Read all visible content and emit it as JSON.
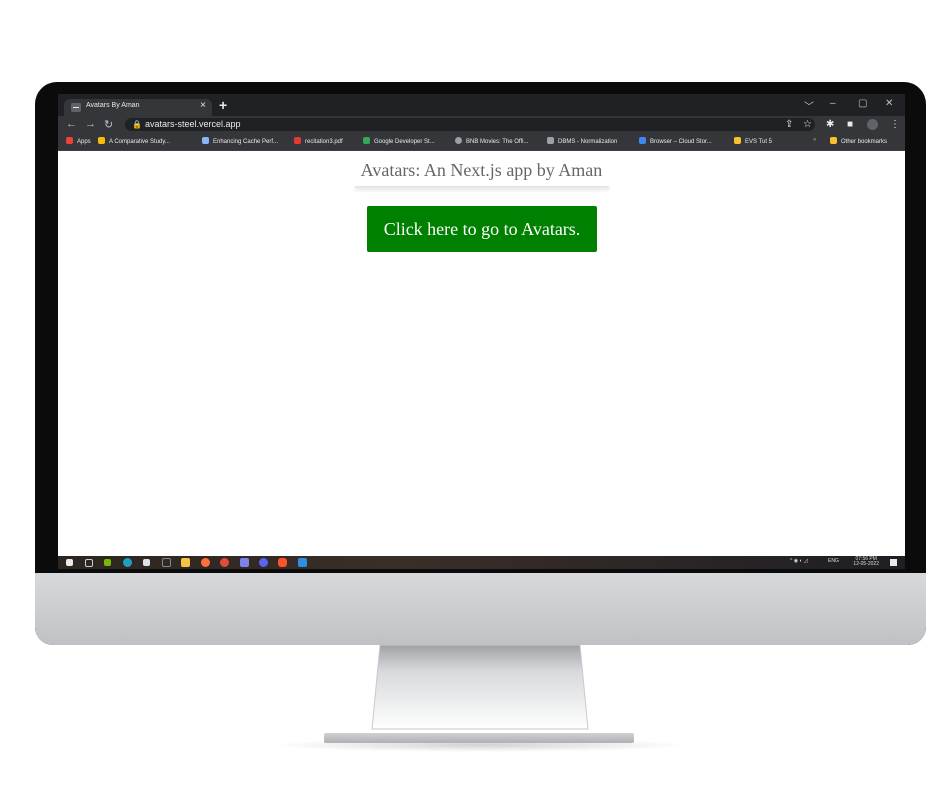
{
  "browser": {
    "tab_title": "Avatars By Aman",
    "tab_close": "×",
    "new_tab": "+",
    "url": "avatars-steel.vercel.app",
    "window_controls": [
      "﹀",
      "–",
      "▢",
      "✕"
    ]
  },
  "bookmarks": [
    {
      "label": "Apps",
      "color": "#ea4335"
    },
    {
      "label": "A Comparative Study...",
      "color": "#fbbc05"
    },
    {
      "label": "Enhancing Cache Perf...",
      "color": "#8ab4f8"
    },
    {
      "label": "recitation3.pdf",
      "color": "#e53935"
    },
    {
      "label": "Google Developer St...",
      "color": "#34a853"
    },
    {
      "label": "BNB Movies: The Offi...",
      "color": "#9aa0a6"
    },
    {
      "label": "DBMS - Normalization",
      "color": "#9aa0a6"
    },
    {
      "label": "Browser – Cloud Stor...",
      "color": "#4285f4"
    },
    {
      "label": "EVS Tut 5",
      "color": "#fbc02d"
    }
  ],
  "other_bookmarks": "Other bookmarks",
  "page": {
    "title": "Avatars: An Next.js app by Aman",
    "cta_label": "Click here to go to Avatars."
  },
  "taskbar": {
    "icons": [
      "windows-start-icon",
      "task-view-icon",
      "nvidia-icon",
      "edge-icon",
      "store-icon",
      "settings-icon",
      "explorer-icon",
      "brave-icon",
      "chrome-icon",
      "teams-icon",
      "discord-icon",
      "brave-dev-icon",
      "vscode-icon"
    ],
    "language": "ENG",
    "time": "07:56 PM",
    "date": "12-05-2022"
  },
  "colors": {
    "accent_green": "#008000",
    "title_gray": "#666666",
    "chrome_dark": "#202124"
  }
}
